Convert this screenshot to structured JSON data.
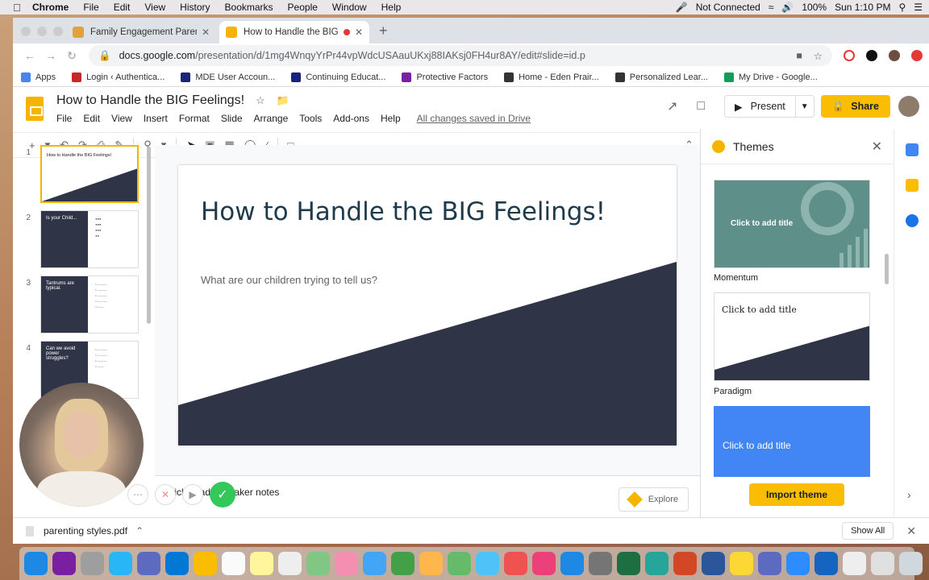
{
  "menubar": {
    "app": "Chrome",
    "items": [
      "File",
      "Edit",
      "View",
      "History",
      "Bookmarks",
      "People",
      "Window",
      "Help"
    ],
    "network": "Not Connected",
    "battery": "100%",
    "clock": "Sun 1:10 PM"
  },
  "tabs": [
    {
      "title": "Family Engagement Parent Re",
      "color": "#e0a33a"
    },
    {
      "title": "How to Handle the BIG Fee",
      "color": "#f4b400"
    }
  ],
  "url": {
    "host": "docs.google.com",
    "path": "/presentation/d/1mg4WnqyYrPr44vpWdcUSAauUKxj88IAKsj0FH4ur8AY/edit#slide=id.p"
  },
  "bookmarks": [
    {
      "label": "Apps",
      "color": "#4285f4"
    },
    {
      "label": "Login ‹ Authentica...",
      "color": "#c62828"
    },
    {
      "label": "MDE User Accoun...",
      "color": "#1a237e"
    },
    {
      "label": "Continuing Educat...",
      "color": "#1a237e"
    },
    {
      "label": "Protective Factors",
      "color": "#7b1fa2"
    },
    {
      "label": "Home - Eden Prair...",
      "color": "#333333"
    },
    {
      "label": "Personalized Lear...",
      "color": "#333333"
    },
    {
      "label": "My Drive - Google...",
      "color": "#0f9d58"
    }
  ],
  "doc": {
    "title": "How to Handle the BIG Feelings!",
    "menus": [
      "File",
      "Edit",
      "View",
      "Insert",
      "Format",
      "Slide",
      "Arrange",
      "Tools",
      "Add-ons",
      "Help"
    ],
    "saved": "All changes saved in Drive"
  },
  "header_buttons": {
    "present": "Present",
    "share": "Share"
  },
  "slides": [
    {
      "num": "1",
      "title": "How to Handle the BIG Feelings!"
    },
    {
      "num": "2",
      "title": "Is your Child..."
    },
    {
      "num": "3",
      "title": "Tantrums are typical."
    },
    {
      "num": "4",
      "title": "Can we avoid power struggles?"
    }
  ],
  "slide": {
    "title": "How to Handle the BIG Feelings!",
    "subtitle": "What are our children trying to tell us?",
    "dark_color": "#2f3547"
  },
  "notes": {
    "placeholder": "Click to add speaker notes",
    "explore": "Explore"
  },
  "themes": {
    "header": "Themes",
    "cards": [
      {
        "name": "Momentum",
        "title": "Click to add title"
      },
      {
        "name": "Paradigm",
        "title": "Click to add title"
      },
      {
        "name": "",
        "title": "Click to add title"
      }
    ],
    "import": "Import theme"
  },
  "download": {
    "file": "parenting styles.pdf",
    "show_all": "Show All"
  }
}
